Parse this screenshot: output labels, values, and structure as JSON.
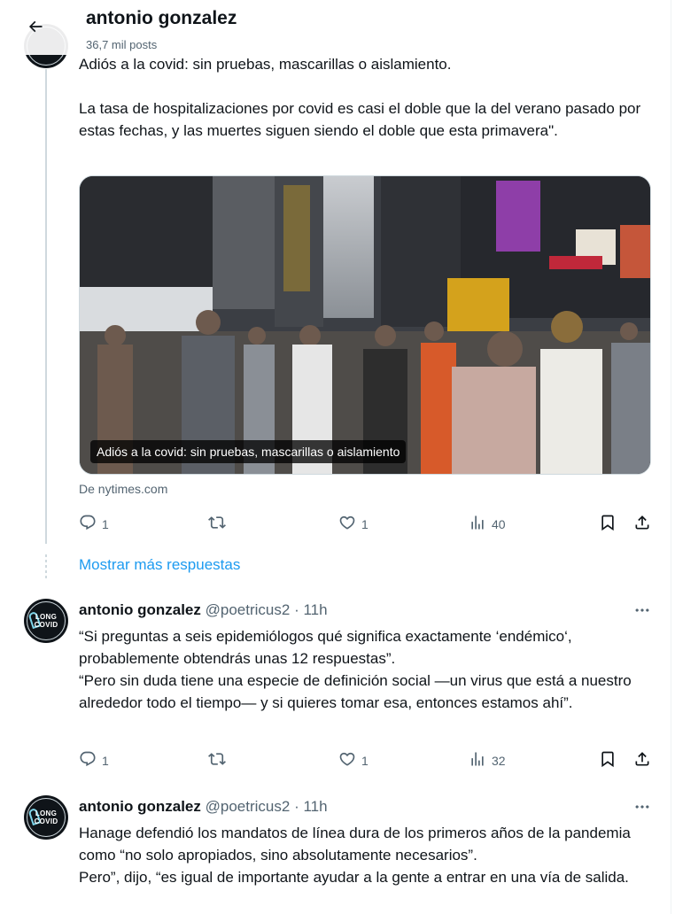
{
  "header": {
    "title": "antonio gonzalez",
    "subtitle": "36,7 mil posts"
  },
  "tweets": [
    {
      "text": "Adiós a la covid: sin pruebas, mascarillas o aislamiento.\n\nLa tasa de hospitalizaciones por covid es casi el doble que la del verano pasado por estas fechas, y las muertes siguen siendo el doble que esta primavera\".",
      "card": {
        "caption": "Adiós a la covid: sin pruebas, mascarillas o aislamiento",
        "source": "De nytimes.com"
      },
      "stats": {
        "replies": "1",
        "reposts": "",
        "likes": "1",
        "views": "40"
      }
    },
    {
      "name": "antonio gonzalez",
      "handle": "@poetricus2",
      "sep": "·",
      "time": "11h",
      "text": "“Si preguntas a seis epidemiólogos qué significa exactamente ‘endémico‘, probablemente obtendrás unas 12 respuestas”.\n “Pero sin duda tiene una especie de definición social —un virus que está a nuestro alrededor todo el tiempo— y si quieres tomar esa, entonces estamos ahí”.",
      "stats": {
        "replies": "1",
        "reposts": "",
        "likes": "1",
        "views": "32"
      }
    },
    {
      "name": "antonio gonzalez",
      "handle": "@poetricus2",
      "sep": "·",
      "time": "11h",
      "text": "Hanage defendió los mandatos de línea dura de los primeros años de la pandemia como “no solo apropiados, sino absolutamente necesarios”.\nPero”, dijo, “es igual de importante ayudar a la gente a entrar en una vía de salida."
    }
  ],
  "more_replies": "Mostrar más respuestas",
  "avatar": {
    "line1": "LONG",
    "line2": "COVID"
  },
  "icons": {
    "back": "arrow-left-icon",
    "reply": "reply-icon",
    "repost": "repost-icon",
    "like": "heart-icon",
    "views": "views-icon",
    "bookmark": "bookmark-icon",
    "share": "share-icon",
    "more": "more-icon"
  },
  "colors": {
    "accent": "#1d9bf0",
    "muted": "#536471",
    "text": "#0f1419"
  }
}
